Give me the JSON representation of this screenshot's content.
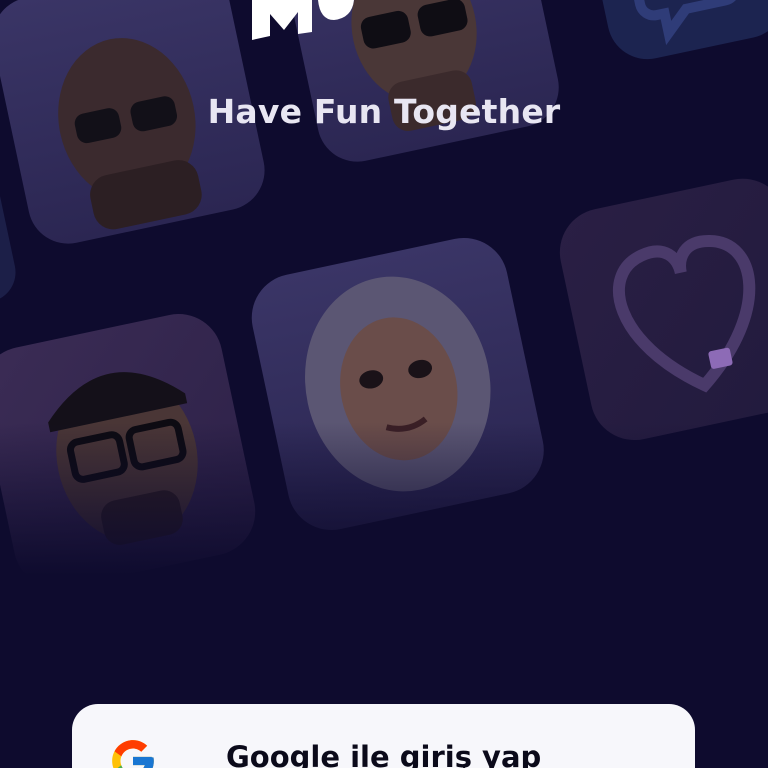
{
  "app": {
    "logo_icon": "app-logo-icon",
    "tagline": "Have Fun Together"
  },
  "background": {
    "tiles": [
      {
        "kind": "avatar",
        "description_icon": "avatar-with-sunglasses-icon"
      },
      {
        "kind": "avatar",
        "description_icon": "avatar-with-sunglasses-icon"
      },
      {
        "kind": "icon",
        "description_icon": "chat-bubble-icon"
      },
      {
        "kind": "avatar",
        "description_icon": "avatar-with-cap-and-glasses-icon"
      },
      {
        "kind": "avatar",
        "description_icon": "avatar-with-hijab-icon"
      },
      {
        "kind": "icon",
        "description_icon": "heart-icon"
      }
    ]
  },
  "login": {
    "google_label": "Google ile giriş yap",
    "google_icon": "google-logo-icon"
  },
  "colors": {
    "background": "#0e0b2e",
    "tile": "#2a2550",
    "button": "#f7f7fb",
    "accent": "#8d6bb6"
  }
}
